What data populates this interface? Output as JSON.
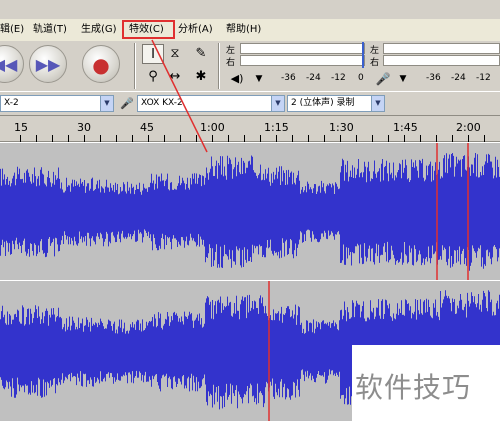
{
  "menubar": {
    "items": [
      {
        "label": "辑(E)"
      },
      {
        "label": "轨道(T)"
      },
      {
        "label": "生成(G)"
      },
      {
        "label": "特效(C)"
      },
      {
        "label": "分析(A)"
      },
      {
        "label": "帮助(H)"
      }
    ]
  },
  "meters": {
    "output": {
      "left_label": "左",
      "right_label": "右"
    },
    "input": {
      "left_label": "左",
      "right_label": "右"
    },
    "ticks": [
      "-36",
      "-24",
      "-12",
      "0"
    ]
  },
  "devices": {
    "playback_device": "X-2",
    "recording_device": "XOX KX-2",
    "channels": "2 (立体声) 录制"
  },
  "timeline": {
    "labels": [
      "15",
      "30",
      "45",
      "1:00",
      "1:15",
      "1:30",
      "1:45",
      "2:00"
    ]
  },
  "colors": {
    "waveform": "#3333cc",
    "track_bg": "#c0c0c0",
    "cursor": "#e03030",
    "highlight": "#e03030"
  },
  "watermark": {
    "text": "软件技巧"
  }
}
